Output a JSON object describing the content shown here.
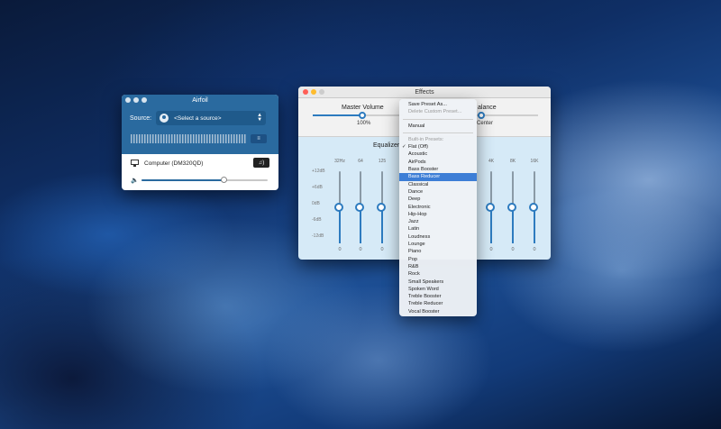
{
  "airfoil": {
    "title": "Airfoil",
    "source_label": "Source:",
    "source_value": "<Select a source>",
    "eq_button_icon": "equalizer-sliders-icon",
    "speaker": {
      "name": "Computer (DM320QD)",
      "button_icon": "speaker-wave-icon"
    },
    "volume_level": 0.65
  },
  "effects": {
    "title": "Effects",
    "master_volume": {
      "label": "Master Volume",
      "value": "100%",
      "level": 0.55
    },
    "balance": {
      "label": "alance",
      "value": "Center",
      "level": 0.5
    },
    "equalizer_label": "Equalizer",
    "db_labels": [
      "+12dB",
      "+6dB",
      "0dB",
      "-6dB",
      "-12dB"
    ],
    "bands": [
      {
        "freq": "32Hz",
        "value": "0"
      },
      {
        "freq": "64",
        "value": "0"
      },
      {
        "freq": "125",
        "value": "0"
      },
      {
        "freq": "4K",
        "value": "0"
      },
      {
        "freq": "8K",
        "value": "0"
      },
      {
        "freq": "16K",
        "value": "0"
      }
    ]
  },
  "menu": {
    "top_items": [
      {
        "label": "Save Preset As...",
        "enabled": true
      },
      {
        "label": "Delete Custom Preset...",
        "enabled": false
      }
    ],
    "manual": "Manual",
    "builtin_header": "Built-in Presets:",
    "presets": [
      "Flat (Off)",
      "Acoustic",
      "AirPods",
      "Bass Booster",
      "Bass Reducer",
      "Classical",
      "Dance",
      "Deep",
      "Electronic",
      "Hip-Hop",
      "Jazz",
      "Latin",
      "Loudness",
      "Lounge",
      "Piano",
      "Pop",
      "R&B",
      "Rock",
      "Small Speakers",
      "Spoken Word",
      "Treble Booster",
      "Treble Reducer",
      "Vocal Booster"
    ],
    "checked_preset": "Flat (Off)",
    "highlighted_preset": "Bass Reducer"
  }
}
